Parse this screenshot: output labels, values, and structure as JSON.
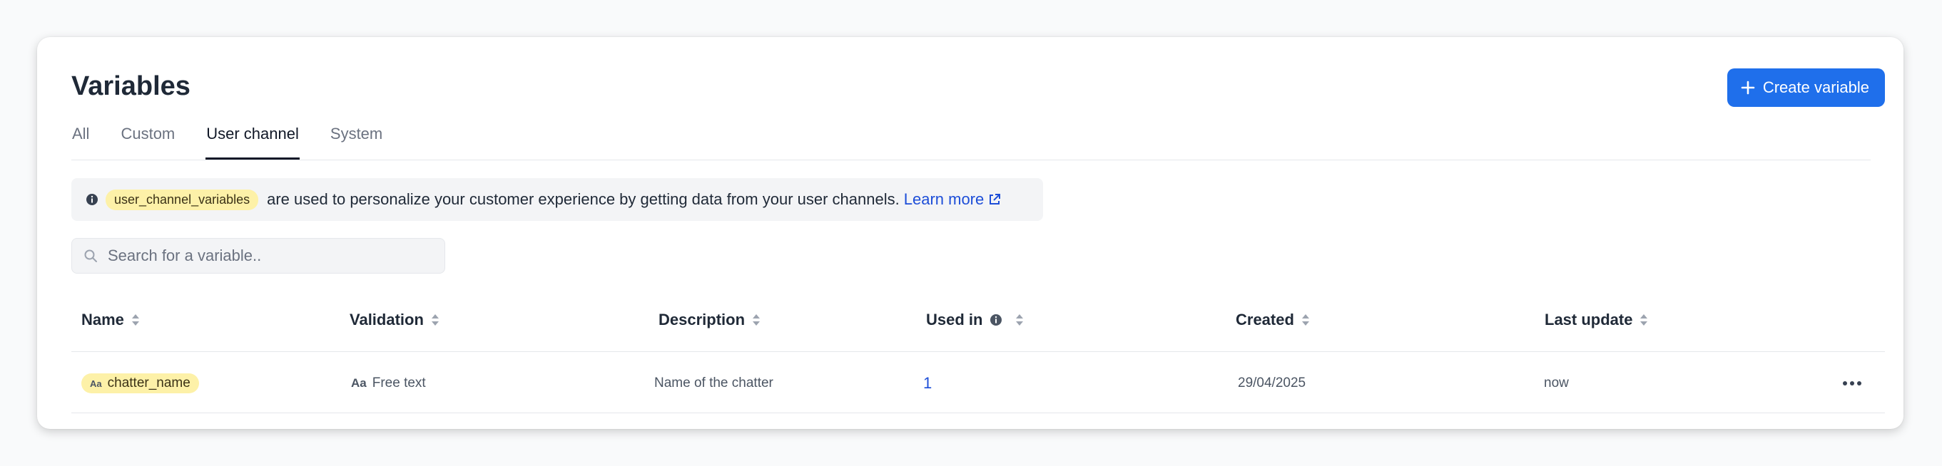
{
  "header": {
    "title": "Variables",
    "create_label": "Create variable"
  },
  "tabs": [
    {
      "label": "All"
    },
    {
      "label": "Custom"
    },
    {
      "label": "User channel",
      "active": true
    },
    {
      "label": "System"
    }
  ],
  "banner": {
    "pill": "user_channel_variables",
    "text": "are used to personalize your customer experience by getting data from your user channels.",
    "link": "Learn more"
  },
  "search": {
    "placeholder": "Search for a variable.."
  },
  "table": {
    "columns": [
      "Name",
      "Validation",
      "Description",
      "Used in",
      "Created",
      "Last update"
    ],
    "rows": [
      {
        "type_icon": "Aa",
        "name": "chatter_name",
        "validation_icon": "Aa",
        "validation": "Free text",
        "description": "Name of the chatter",
        "used_in": "1",
        "created": "29/04/2025",
        "last_update": "now"
      }
    ]
  },
  "colors": {
    "primary": "#1f6feb",
    "pill_bg": "#fdf1a8",
    "link": "#1d4ed8"
  }
}
